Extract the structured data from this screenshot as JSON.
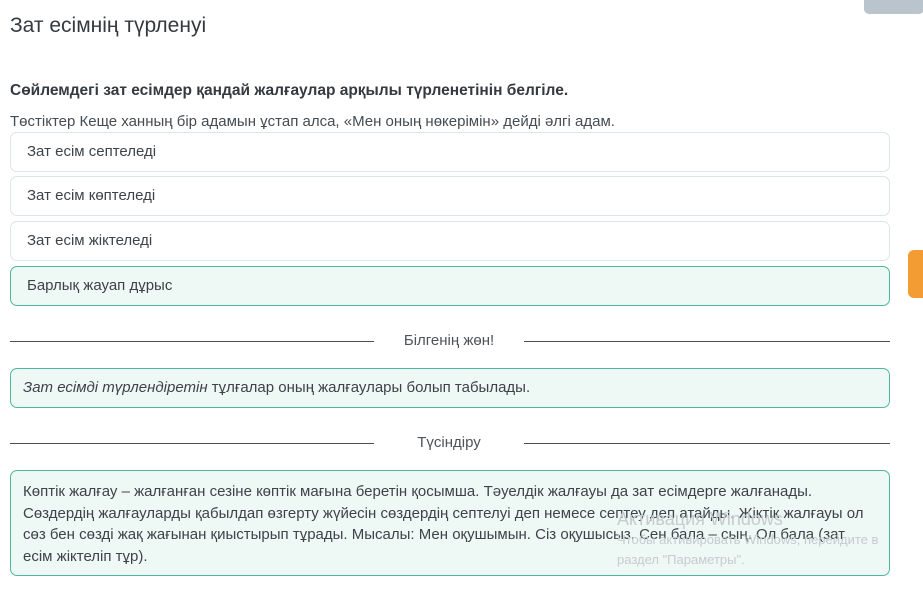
{
  "page": {
    "title": "Зат есімнің түрленуі"
  },
  "question": {
    "prompt": "Сөйлемдегі зат есімдер қандай жалғаулар арқылы түрленетінін белгіле.",
    "sentence": "Төстіктер Кеще ханның бір адамын ұстап алса, «Мен оның нөкерімін» дейді әлгі адам.",
    "options": [
      {
        "label": "Зат есім септеледі",
        "state": "default"
      },
      {
        "label": "Зат есім көптеледі",
        "state": "default"
      },
      {
        "label": "Зат есім жіктеледі",
        "state": "default"
      },
      {
        "label": "Барлық жауап дұрыс",
        "state": "correct"
      }
    ]
  },
  "know_section": {
    "heading": "Білгенің жөн!",
    "fact_italic": "Зат есімді түрлендіретін",
    "fact_rest": " тұлғалар оның жалғаулары болып табылады."
  },
  "explanation_section": {
    "heading": "Түсіндіру",
    "text": "Көптік жалғау – жалғанған сезіне көптік мағына беретін қосымша. Тәуелдік жалғауы да зат есімдерге жалғанады. Сөздердің жалғауларды қабылдап өзгерту жүйесін сөздердің септелуі деп немесе септеу деп атайды. Жіктік жалғауы ол сөз бен сөзді жақ жағынан қиыстырып тұрады. Мысалы: Мен оқушымын. Сіз оқушысыз. Сен бала – сың. Ол бала (зат есім жіктеліп тұр)."
  },
  "watermark": {
    "title": "Активация Windows",
    "subtitle_line1": "Чтобы активировать Windows, перейдите в",
    "subtitle_line2": "раздел \"Параметры\"."
  },
  "colors": {
    "correct_border": "#4fb7a0",
    "correct_background": "#eef8f4",
    "side_tab": "#f39c33"
  }
}
